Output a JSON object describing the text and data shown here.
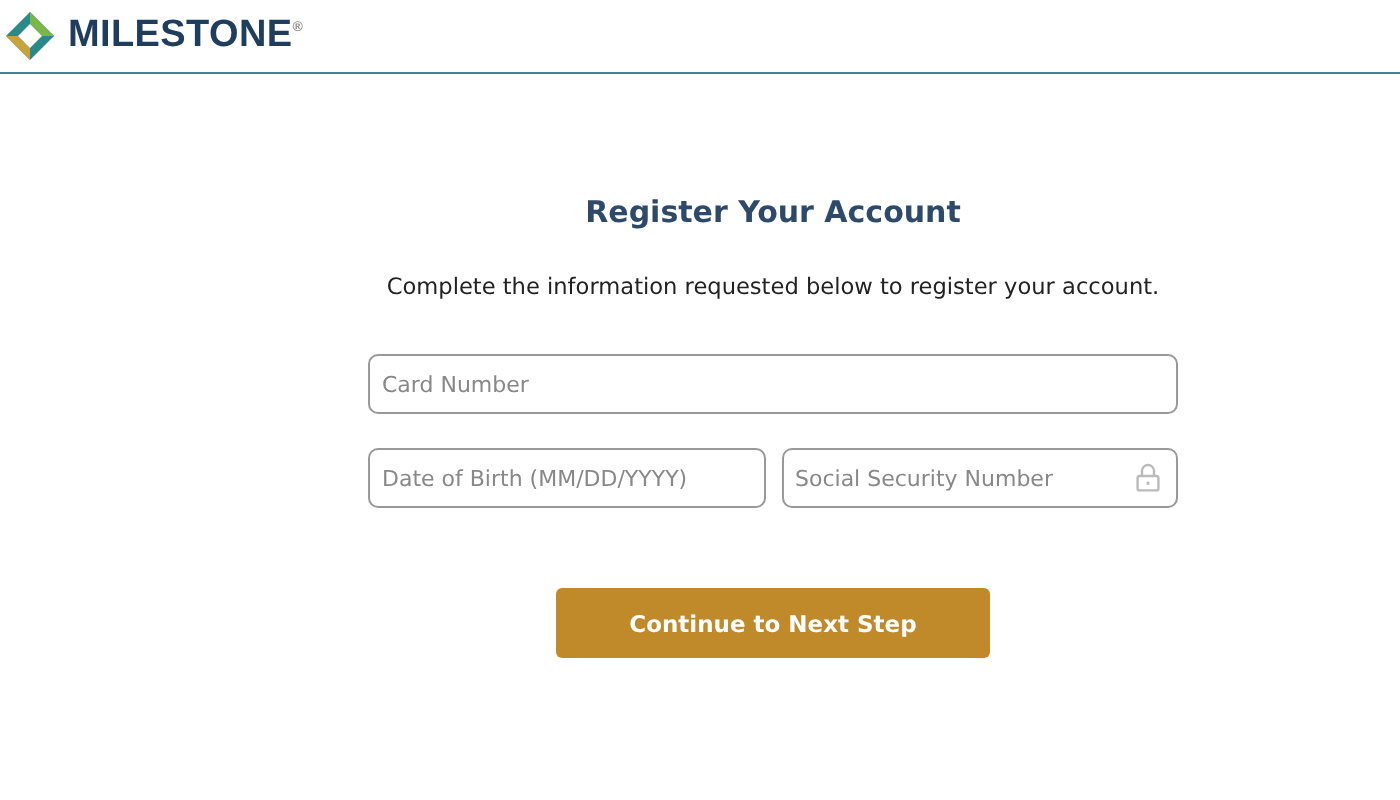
{
  "header": {
    "brand": "MILESTONE$^{®}$"
  },
  "title": "Register Your Account",
  "instructions": "Complete the information requested below to register your account.",
  "field_rows": [
    [
      {
        "kind": "text",
        "placeholder": "Card Number"
      }
    ],
    [
      {
        "kind": "text",
        "placeholder": "Date of Birth (MM/DD/YYYY)"
      },
      {
        "kind": "secure",
        "placeholder": "Social Security Number"
      }
    ]
  ],
  "button": "Continue to Next Step"
}
